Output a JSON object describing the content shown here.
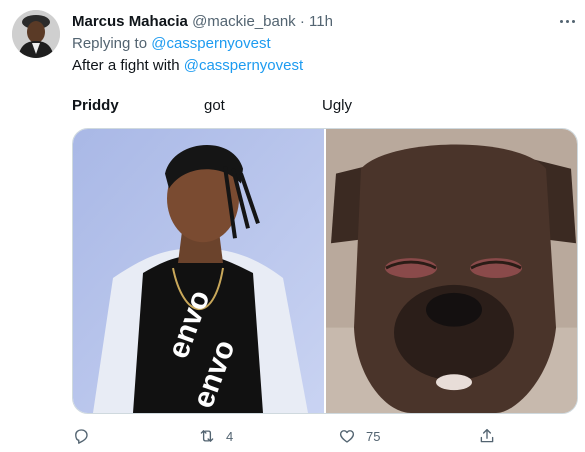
{
  "author": {
    "name": "Marcus Mahacia",
    "handle": "@mackie_bank",
    "separator": "·",
    "time": "11h"
  },
  "reply": {
    "prefix": "Replying to ",
    "mention": "@casspernyovest"
  },
  "tweet": {
    "text": "After a fight with ",
    "mention": "@casspernyovest"
  },
  "labels": {
    "left": "Priddy",
    "middle": "got",
    "right": "Ugly"
  },
  "media_text": {
    "left_shirt": "envo"
  },
  "actions": {
    "reply_count": "",
    "retweet_count": "4",
    "like_count": "75"
  },
  "colors": {
    "link": "#1d9bf0",
    "secondary": "#536471",
    "text": "#0f1419"
  },
  "icons": [
    "more-icon",
    "reply-icon",
    "retweet-icon",
    "like-icon",
    "share-icon"
  ]
}
